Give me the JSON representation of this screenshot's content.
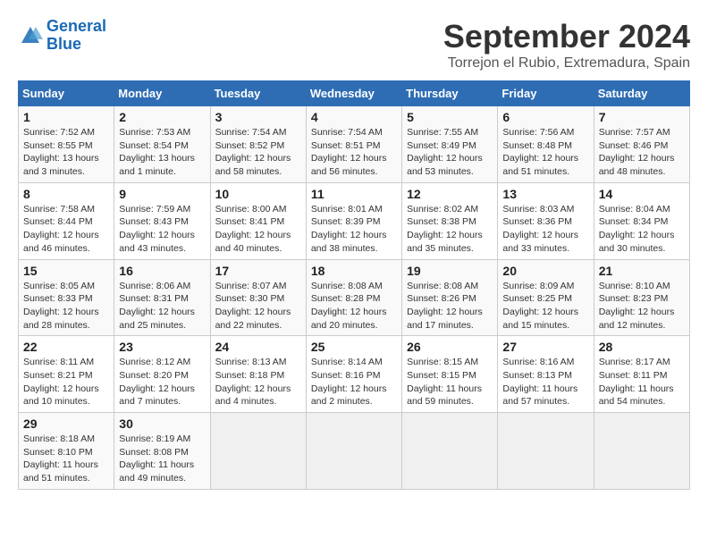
{
  "header": {
    "logo_line1": "General",
    "logo_line2": "Blue",
    "month_title": "September 2024",
    "location": "Torrejon el Rubio, Extremadura, Spain"
  },
  "weekdays": [
    "Sunday",
    "Monday",
    "Tuesday",
    "Wednesday",
    "Thursday",
    "Friday",
    "Saturday"
  ],
  "weeks": [
    [
      {
        "day": "1",
        "info": "Sunrise: 7:52 AM\nSunset: 8:55 PM\nDaylight: 13 hours and 3 minutes."
      },
      {
        "day": "2",
        "info": "Sunrise: 7:53 AM\nSunset: 8:54 PM\nDaylight: 13 hours and 1 minute."
      },
      {
        "day": "3",
        "info": "Sunrise: 7:54 AM\nSunset: 8:52 PM\nDaylight: 12 hours and 58 minutes."
      },
      {
        "day": "4",
        "info": "Sunrise: 7:54 AM\nSunset: 8:51 PM\nDaylight: 12 hours and 56 minutes."
      },
      {
        "day": "5",
        "info": "Sunrise: 7:55 AM\nSunset: 8:49 PM\nDaylight: 12 hours and 53 minutes."
      },
      {
        "day": "6",
        "info": "Sunrise: 7:56 AM\nSunset: 8:48 PM\nDaylight: 12 hours and 51 minutes."
      },
      {
        "day": "7",
        "info": "Sunrise: 7:57 AM\nSunset: 8:46 PM\nDaylight: 12 hours and 48 minutes."
      }
    ],
    [
      {
        "day": "8",
        "info": "Sunrise: 7:58 AM\nSunset: 8:44 PM\nDaylight: 12 hours and 46 minutes."
      },
      {
        "day": "9",
        "info": "Sunrise: 7:59 AM\nSunset: 8:43 PM\nDaylight: 12 hours and 43 minutes."
      },
      {
        "day": "10",
        "info": "Sunrise: 8:00 AM\nSunset: 8:41 PM\nDaylight: 12 hours and 40 minutes."
      },
      {
        "day": "11",
        "info": "Sunrise: 8:01 AM\nSunset: 8:39 PM\nDaylight: 12 hours and 38 minutes."
      },
      {
        "day": "12",
        "info": "Sunrise: 8:02 AM\nSunset: 8:38 PM\nDaylight: 12 hours and 35 minutes."
      },
      {
        "day": "13",
        "info": "Sunrise: 8:03 AM\nSunset: 8:36 PM\nDaylight: 12 hours and 33 minutes."
      },
      {
        "day": "14",
        "info": "Sunrise: 8:04 AM\nSunset: 8:34 PM\nDaylight: 12 hours and 30 minutes."
      }
    ],
    [
      {
        "day": "15",
        "info": "Sunrise: 8:05 AM\nSunset: 8:33 PM\nDaylight: 12 hours and 28 minutes."
      },
      {
        "day": "16",
        "info": "Sunrise: 8:06 AM\nSunset: 8:31 PM\nDaylight: 12 hours and 25 minutes."
      },
      {
        "day": "17",
        "info": "Sunrise: 8:07 AM\nSunset: 8:30 PM\nDaylight: 12 hours and 22 minutes."
      },
      {
        "day": "18",
        "info": "Sunrise: 8:08 AM\nSunset: 8:28 PM\nDaylight: 12 hours and 20 minutes."
      },
      {
        "day": "19",
        "info": "Sunrise: 8:08 AM\nSunset: 8:26 PM\nDaylight: 12 hours and 17 minutes."
      },
      {
        "day": "20",
        "info": "Sunrise: 8:09 AM\nSunset: 8:25 PM\nDaylight: 12 hours and 15 minutes."
      },
      {
        "day": "21",
        "info": "Sunrise: 8:10 AM\nSunset: 8:23 PM\nDaylight: 12 hours and 12 minutes."
      }
    ],
    [
      {
        "day": "22",
        "info": "Sunrise: 8:11 AM\nSunset: 8:21 PM\nDaylight: 12 hours and 10 minutes."
      },
      {
        "day": "23",
        "info": "Sunrise: 8:12 AM\nSunset: 8:20 PM\nDaylight: 12 hours and 7 minutes."
      },
      {
        "day": "24",
        "info": "Sunrise: 8:13 AM\nSunset: 8:18 PM\nDaylight: 12 hours and 4 minutes."
      },
      {
        "day": "25",
        "info": "Sunrise: 8:14 AM\nSunset: 8:16 PM\nDaylight: 12 hours and 2 minutes."
      },
      {
        "day": "26",
        "info": "Sunrise: 8:15 AM\nSunset: 8:15 PM\nDaylight: 11 hours and 59 minutes."
      },
      {
        "day": "27",
        "info": "Sunrise: 8:16 AM\nSunset: 8:13 PM\nDaylight: 11 hours and 57 minutes."
      },
      {
        "day": "28",
        "info": "Sunrise: 8:17 AM\nSunset: 8:11 PM\nDaylight: 11 hours and 54 minutes."
      }
    ],
    [
      {
        "day": "29",
        "info": "Sunrise: 8:18 AM\nSunset: 8:10 PM\nDaylight: 11 hours and 51 minutes."
      },
      {
        "day": "30",
        "info": "Sunrise: 8:19 AM\nSunset: 8:08 PM\nDaylight: 11 hours and 49 minutes."
      },
      {
        "day": "",
        "info": ""
      },
      {
        "day": "",
        "info": ""
      },
      {
        "day": "",
        "info": ""
      },
      {
        "day": "",
        "info": ""
      },
      {
        "day": "",
        "info": ""
      }
    ]
  ]
}
